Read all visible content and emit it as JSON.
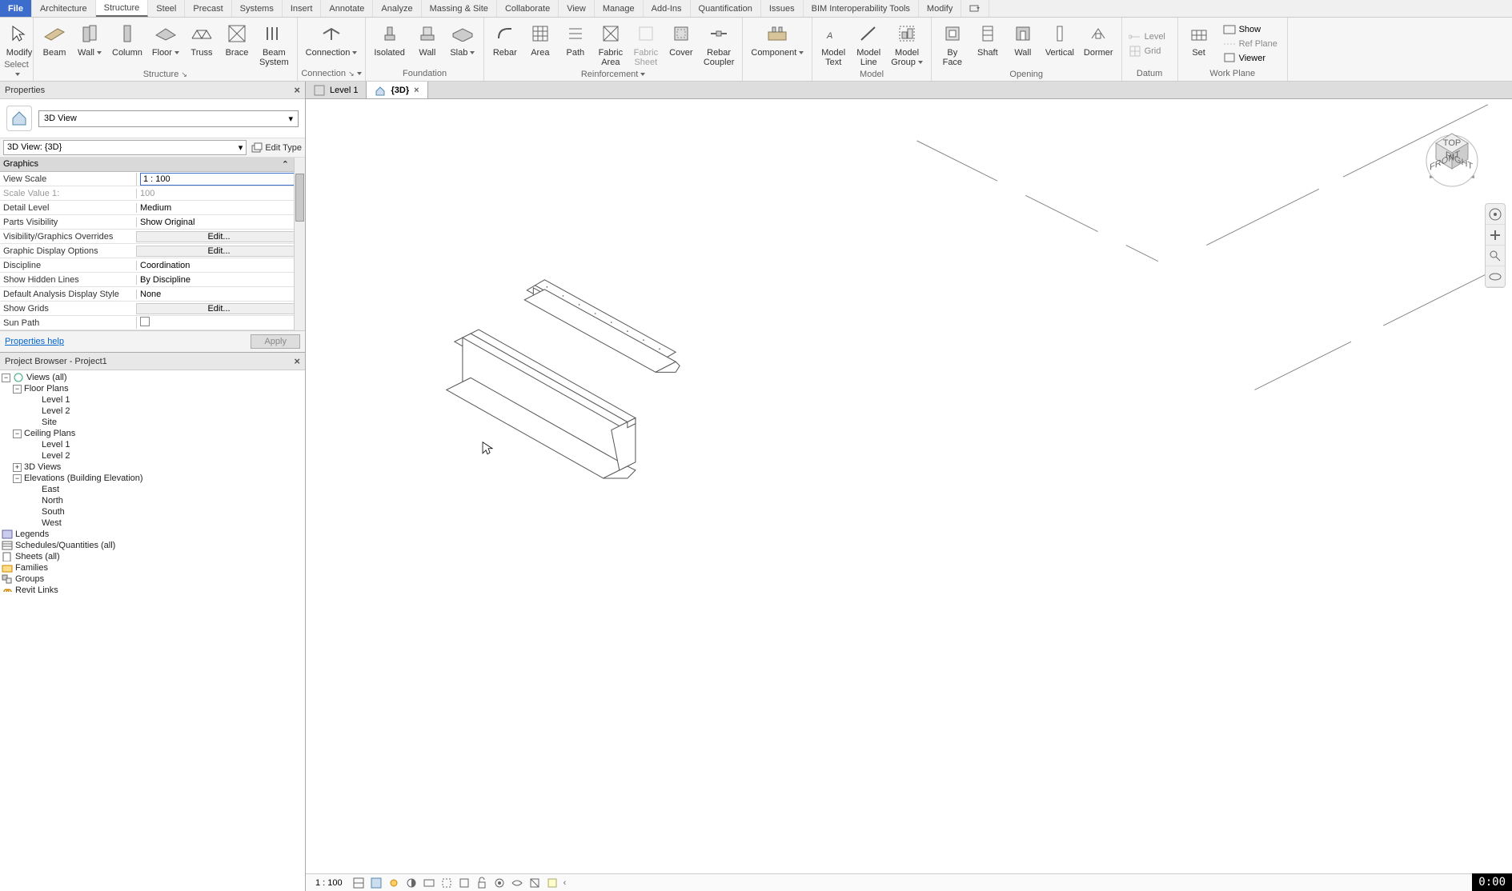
{
  "top_tabs": {
    "file": "File",
    "items": [
      "Architecture",
      "Structure",
      "Steel",
      "Precast",
      "Systems",
      "Insert",
      "Annotate",
      "Analyze",
      "Massing & Site",
      "Collaborate",
      "View",
      "Manage",
      "Add-Ins",
      "Quantification",
      "Issues",
      "BIM Interoperability Tools",
      "Modify"
    ],
    "active": "Structure"
  },
  "ribbon": {
    "select": {
      "modify": "Modify",
      "select_label": "Select"
    },
    "structure": {
      "beam": "Beam",
      "wall": "Wall",
      "column": "Column",
      "floor": "Floor",
      "truss": "Truss",
      "brace": "Brace",
      "beam_system": "Beam\nSystem",
      "title": "Structure"
    },
    "connection": {
      "connection": "Connection",
      "title": "Connection"
    },
    "foundation": {
      "isolated": "Isolated",
      "wall": "Wall",
      "slab": "Slab",
      "title": "Foundation"
    },
    "reinforcement": {
      "rebar": "Rebar",
      "area": "Area",
      "path": "Path",
      "fabric_area": "Fabric\nArea",
      "fabric_sheet": "Fabric\nSheet",
      "cover": "Cover",
      "rebar_coupler": "Rebar\nCoupler",
      "title": "Reinforcement"
    },
    "component": {
      "label": "Component"
    },
    "model": {
      "model_text": "Model\nText",
      "model_line": "Model\nLine",
      "model_group": "Model\nGroup",
      "title": "Model"
    },
    "opening": {
      "by_face": "By\nFace",
      "shaft": "Shaft",
      "wall": "Wall",
      "vertical": "Vertical",
      "dormer": "Dormer",
      "title": "Opening"
    },
    "datum": {
      "level": "Level",
      "grid": "Grid",
      "title": "Datum"
    },
    "workplane": {
      "set": "Set",
      "show": "Show",
      "ref_plane": "Ref Plane",
      "viewer": "Viewer",
      "title": "Work Plane"
    }
  },
  "properties": {
    "header": "Properties",
    "type_name": "3D View",
    "filter": "3D View: {3D}",
    "edit_type": "Edit Type",
    "section": "Graphics",
    "rows": {
      "view_scale_l": "View Scale",
      "view_scale_v": "1 : 100",
      "scale_value_l": "Scale Value    1:",
      "scale_value_v": "100",
      "detail_level_l": "Detail Level",
      "detail_level_v": "Medium",
      "parts_vis_l": "Parts Visibility",
      "parts_vis_v": "Show Original",
      "vg_over_l": "Visibility/Graphics Overrides",
      "vg_over_v": "Edit...",
      "gdisp_l": "Graphic Display Options",
      "gdisp_v": "Edit...",
      "discipline_l": "Discipline",
      "discipline_v": "Coordination",
      "hidden_l": "Show Hidden Lines",
      "hidden_v": "By Discipline",
      "analysis_l": "Default Analysis Display Style",
      "analysis_v": "None",
      "grids_l": "Show Grids",
      "grids_v": "Edit...",
      "sunpath_l": "Sun Path"
    },
    "help": "Properties help",
    "apply": "Apply"
  },
  "project_browser": {
    "header": "Project Browser - Project1",
    "views_all": "Views (all)",
    "floor_plans": "Floor Plans",
    "fp_level1": "Level 1",
    "fp_level2": "Level 2",
    "fp_site": "Site",
    "ceiling_plans": "Ceiling Plans",
    "cp_level1": "Level 1",
    "cp_level2": "Level 2",
    "three_d": "3D Views",
    "elevations": "Elevations (Building Elevation)",
    "el_east": "East",
    "el_north": "North",
    "el_south": "South",
    "el_west": "West",
    "legends": "Legends",
    "schedules": "Schedules/Quantities (all)",
    "sheets": "Sheets (all)",
    "families": "Families",
    "groups": "Groups",
    "revit_links": "Revit Links"
  },
  "view_tabs": {
    "level1": "Level 1",
    "three_d": "{3D}"
  },
  "viewcube": {
    "top": "TOP",
    "front": "FRONT",
    "right": "RIGHT"
  },
  "status": {
    "scale": "1 : 100"
  },
  "time_badge": "0:00"
}
